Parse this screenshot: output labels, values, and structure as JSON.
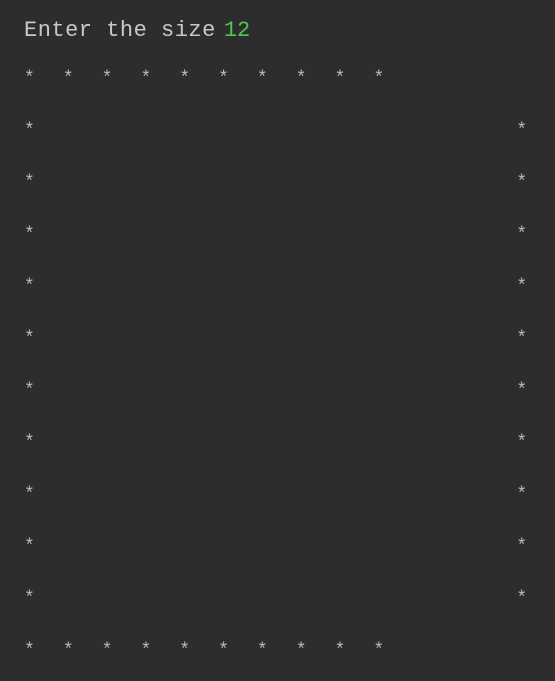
{
  "header": {
    "prefix": "Enter the size",
    "value": "12"
  },
  "grid": {
    "size": 12,
    "star_char": "★",
    "top_row_count": 10,
    "bottom_row_count": 10,
    "middle_row_count": 10,
    "middle_rows": 10
  }
}
